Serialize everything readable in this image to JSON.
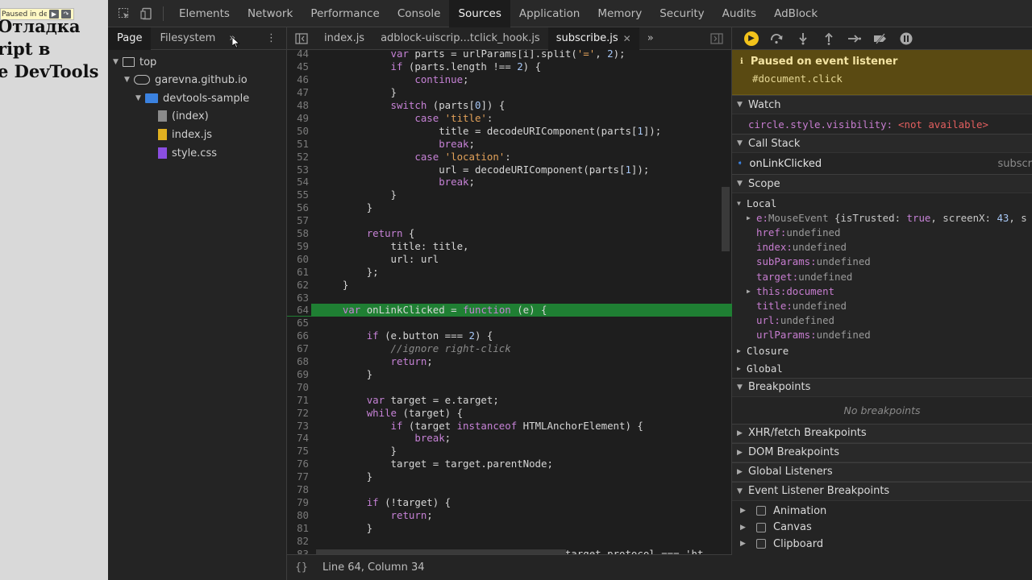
{
  "page": {
    "debug_banner": "Paused in debugger",
    "heading_lines": [
      "Отладка",
      "ript в",
      "e DevTools"
    ]
  },
  "devtools": {
    "tabs": [
      "Elements",
      "Network",
      "Performance",
      "Console",
      "Sources",
      "Application",
      "Memory",
      "Security",
      "Audits",
      "AdBlock"
    ],
    "active_tab": "Sources"
  },
  "navigator": {
    "tabs": [
      "Page",
      "Filesystem"
    ],
    "tree": [
      {
        "label": "top",
        "icon": "frame-icon"
      },
      {
        "label": "garevna.github.io",
        "icon": "cloud-icon"
      },
      {
        "label": "devtools-sample",
        "icon": "folder-icon"
      },
      {
        "label": "(index)",
        "icon": "file-icon"
      },
      {
        "label": "index.js",
        "icon": "js-file-icon"
      },
      {
        "label": "style.css",
        "icon": "css-file-icon"
      }
    ]
  },
  "editor": {
    "tabs": [
      "index.js",
      "adblock-uiscrip...tclick_hook.js",
      "subscribe.js"
    ],
    "active_tab": "subscribe.js",
    "status": "Line 64, Column 34",
    "paused_line": 64,
    "lines": [
      {
        "n": "44",
        "code": "            var parts = urlParams[i].split('=', 2);"
      },
      {
        "n": "45",
        "code": "            if (parts.length !== 2) {"
      },
      {
        "n": "46",
        "code": "                continue;"
      },
      {
        "n": "47",
        "code": "            }"
      },
      {
        "n": "48",
        "code": "            switch (parts[0]) {"
      },
      {
        "n": "49",
        "code": "                case 'title':"
      },
      {
        "n": "50",
        "code": "                    title = decodeURIComponent(parts[1]);"
      },
      {
        "n": "51",
        "code": "                    break;"
      },
      {
        "n": "52",
        "code": "                case 'location':"
      },
      {
        "n": "53",
        "code": "                    url = decodeURIComponent(parts[1]);"
      },
      {
        "n": "54",
        "code": "                    break;"
      },
      {
        "n": "55",
        "code": "            }"
      },
      {
        "n": "56",
        "code": "        }"
      },
      {
        "n": "57",
        "code": ""
      },
      {
        "n": "58",
        "code": "        return {"
      },
      {
        "n": "59",
        "code": "            title: title,"
      },
      {
        "n": "60",
        "code": "            url: url"
      },
      {
        "n": "61",
        "code": "        };"
      },
      {
        "n": "62",
        "code": "    }"
      },
      {
        "n": "63",
        "code": ""
      },
      {
        "n": "64",
        "code": "    var onLinkClicked = function (e) {"
      },
      {
        "n": "65",
        "code": ""
      },
      {
        "n": "66",
        "code": "        if (e.button === 2) {"
      },
      {
        "n": "67",
        "code": "            //ignore right-click"
      },
      {
        "n": "68",
        "code": "            return;"
      },
      {
        "n": "69",
        "code": "        }"
      },
      {
        "n": "70",
        "code": ""
      },
      {
        "n": "71",
        "code": "        var target = e.target;"
      },
      {
        "n": "72",
        "code": "        while (target) {"
      },
      {
        "n": "73",
        "code": "            if (target instanceof HTMLAnchorElement) {"
      },
      {
        "n": "74",
        "code": "                break;"
      },
      {
        "n": "75",
        "code": "            }"
      },
      {
        "n": "76",
        "code": "            target = target.parentNode;"
      },
      {
        "n": "77",
        "code": "        }"
      },
      {
        "n": "78",
        "code": ""
      },
      {
        "n": "79",
        "code": "        if (!target) {"
      },
      {
        "n": "80",
        "code": "            return;"
      },
      {
        "n": "81",
        "code": "        }"
      },
      {
        "n": "82",
        "code": ""
      },
      {
        "n": "83",
        "code": "                                         target.protocol === 'ht"
      }
    ]
  },
  "debugger": {
    "paused_title": "Paused on event listener",
    "paused_detail": "#document.click",
    "watch_title": "Watch",
    "watch_expr": "circle.style.visibility:",
    "watch_value": "<not available>",
    "callstack_title": "Call Stack",
    "callstack": [
      {
        "fn": "onLinkClicked",
        "file": "subscr"
      }
    ],
    "scope_title": "Scope",
    "scope_local": "Local",
    "scope_vars": [
      {
        "key": "e",
        "value": "MouseEvent {isTrusted: true, screenX: 43, s",
        "expandable": true,
        "obj": true
      },
      {
        "key": "href",
        "value": "undefined",
        "expandable": false,
        "obj": false
      },
      {
        "key": "index",
        "value": "undefined",
        "expandable": false,
        "obj": false
      },
      {
        "key": "subParams",
        "value": "undefined",
        "expandable": false,
        "obj": false
      },
      {
        "key": "target",
        "value": "undefined",
        "expandable": false,
        "obj": false
      },
      {
        "key": "this",
        "value": "document",
        "expandable": true,
        "obj": true
      },
      {
        "key": "title",
        "value": "undefined",
        "expandable": false,
        "obj": false
      },
      {
        "key": "url",
        "value": "undefined",
        "expandable": false,
        "obj": false
      },
      {
        "key": "urlParams",
        "value": "undefined",
        "expandable": false,
        "obj": false
      }
    ],
    "closure": "Closure",
    "global": "Global",
    "breakpoints_title": "Breakpoints",
    "no_breakpoints": "No breakpoints",
    "xhr_title": "XHR/fetch Breakpoints",
    "dom_title": "DOM Breakpoints",
    "global_listeners_title": "Global Listeners",
    "event_listener_title": "Event Listener Breakpoints",
    "event_categories": [
      "Animation",
      "Canvas",
      "Clipboard"
    ]
  }
}
